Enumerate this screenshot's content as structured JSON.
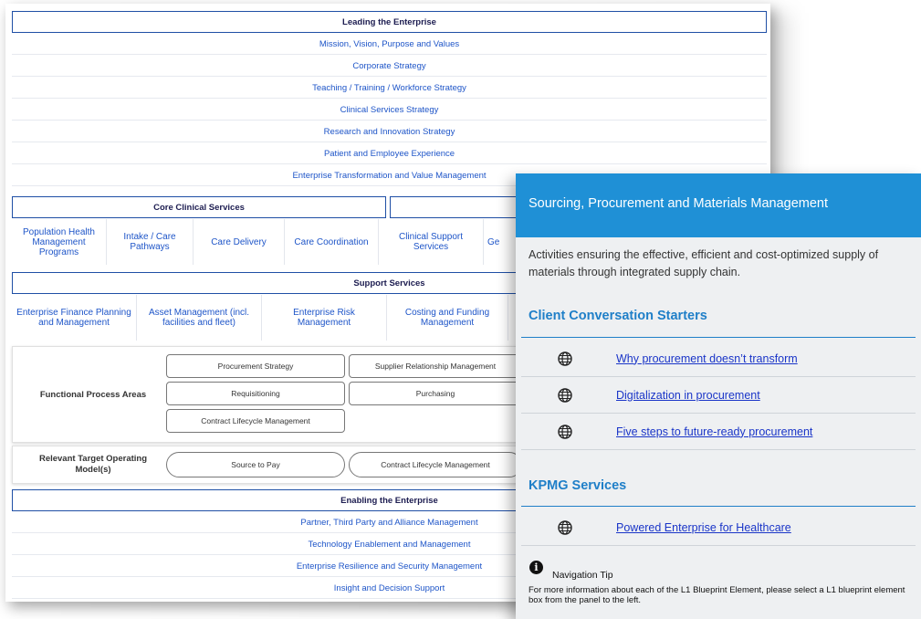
{
  "leading": {
    "header": "Leading the Enterprise",
    "items": [
      "Mission, Vision, Purpose and Values",
      "Corporate Strategy",
      "Teaching / Training / Workforce Strategy",
      "Clinical Services Strategy",
      "Research and Innovation Strategy",
      "Patient and Employee Experience",
      "Enterprise Transformation and Value Management"
    ]
  },
  "core": {
    "header": "Core Clinical Services",
    "items": [
      "Population Health Management Programs",
      "Intake / Care Pathways",
      "Care Delivery",
      "Care Coordination",
      "Clinical Support Services",
      "Ge"
    ]
  },
  "support": {
    "header": "Support Services",
    "items": [
      "Enterprise Finance Planning and Management",
      "Asset Management (incl. facilities and fleet)",
      "Enterprise Risk Management",
      "Costing and Funding Management"
    ]
  },
  "fpa": {
    "label": "Functional Process Areas",
    "items": [
      "Procurement Strategy",
      "Supplier Relationship Management",
      "Requisitioning",
      "Purchasing",
      "Contract Lifecycle Management"
    ]
  },
  "tom": {
    "label": "Relevant Target Operating Model(s)",
    "items": [
      "Source to Pay",
      "Contract Lifecycle Management"
    ]
  },
  "enabling": {
    "header": "Enabling the Enterprise",
    "items": [
      "Partner, Third Party and Alliance Management",
      "Technology Enablement and Management",
      "Enterprise Resilience and Security Management",
      "Insight and Decision Support"
    ]
  },
  "overlay": {
    "title": "Sourcing, Procurement and Materials Management",
    "description": "Activities ensuring the effective, efficient and cost-optimized supply of materials through integrated supply chain.",
    "conversation_heading": "Client Conversation Starters",
    "conversation_links": [
      {
        "icon": "globe-icon",
        "label": "Why procurement doesn’t transform"
      },
      {
        "icon": "globe-icon",
        "label": "Digitalization in procurement"
      },
      {
        "icon": "globe-icon",
        "label": "Five steps to future-ready procurement"
      }
    ],
    "services_heading": "KPMG Services",
    "services_links": [
      {
        "icon": "globe-icon",
        "label": "Powered Enterprise for Healthcare"
      }
    ],
    "tip_icon": "info-icon",
    "tip_title": "Navigation Tip",
    "tip_text": "For more information about each of the L1 Blueprint Element, please select a L1 blueprint element box from the panel to the left."
  },
  "colors": {
    "link": "#1e55c8",
    "header_border": "#1f4fa5",
    "overlay_header": "#1f90d6",
    "section_heading": "#1f7fc8"
  }
}
